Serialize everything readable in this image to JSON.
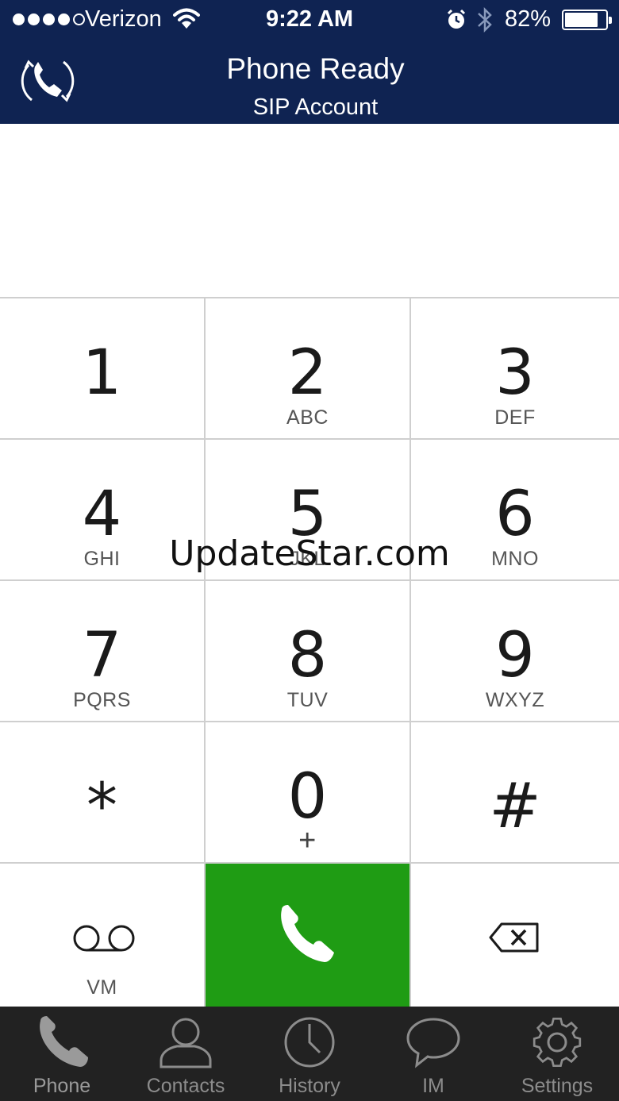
{
  "status_bar": {
    "carrier": "Verizon",
    "time": "9:22 AM",
    "battery_percent": "82%",
    "battery_level": 0.82,
    "signal_bars_filled": 4,
    "signal_bars_total": 5
  },
  "header": {
    "title": "Phone Ready",
    "subtitle": "SIP Account",
    "logo_icon": "phone-sync-icon"
  },
  "display": {
    "number": ""
  },
  "keypad": {
    "keys": [
      {
        "digit": "1",
        "letters": ""
      },
      {
        "digit": "2",
        "letters": "ABC"
      },
      {
        "digit": "3",
        "letters": "DEF"
      },
      {
        "digit": "4",
        "letters": "GHI"
      },
      {
        "digit": "5",
        "letters": "JKL"
      },
      {
        "digit": "6",
        "letters": "MNO"
      },
      {
        "digit": "7",
        "letters": "PQRS"
      },
      {
        "digit": "8",
        "letters": "TUV"
      },
      {
        "digit": "9",
        "letters": "WXYZ"
      },
      {
        "digit": "*",
        "letters": ""
      },
      {
        "digit": "0",
        "letters": "+"
      },
      {
        "digit": "#",
        "letters": ""
      }
    ],
    "voicemail_label": "VM",
    "call_color": "#1f9c14"
  },
  "tabs": [
    {
      "label": "Phone",
      "icon": "phone-icon"
    },
    {
      "label": "Contacts",
      "icon": "contacts-icon"
    },
    {
      "label": "History",
      "icon": "clock-icon"
    },
    {
      "label": "IM",
      "icon": "chat-bubble-icon"
    },
    {
      "label": "Settings",
      "icon": "gear-icon"
    }
  ],
  "watermark": "UpdateStar.com",
  "colors": {
    "header_bg": "#0f2352",
    "tabbar_bg": "#222222",
    "tab_fg": "#8c8c8c"
  }
}
